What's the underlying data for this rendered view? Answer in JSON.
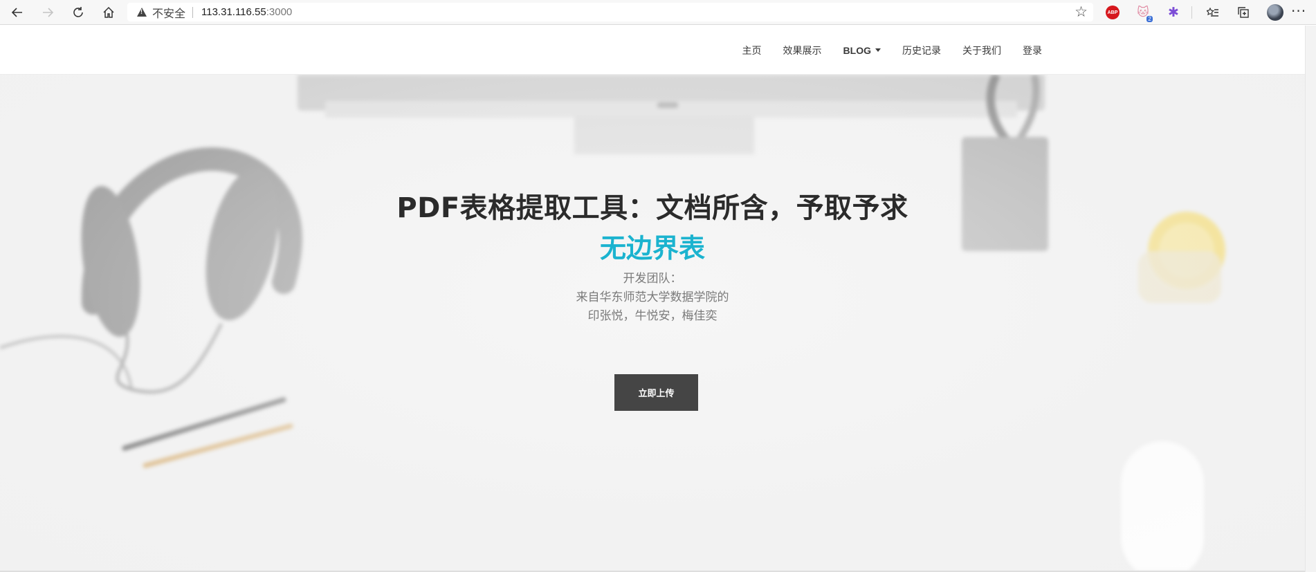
{
  "browser": {
    "security_label": "不安全",
    "url_host": "113.31.116.55",
    "url_port": ":3000",
    "extensions": [
      {
        "icon": "adblock-plus-icon",
        "label": "ABP"
      },
      {
        "icon": "cat-extension-icon",
        "badge": "2"
      },
      {
        "icon": "pinwheel-extension-icon"
      }
    ]
  },
  "nav": {
    "items": [
      {
        "label": "主页"
      },
      {
        "label": "效果展示"
      },
      {
        "label": "BLOG"
      },
      {
        "label": "历史记录"
      },
      {
        "label": "关于我们"
      },
      {
        "label": "登录"
      }
    ]
  },
  "hero": {
    "title": "PDF表格提取工具：文档所含，予取予求",
    "highlight": "无边界表",
    "description_lines": [
      "开发团队：",
      "来自华东师范大学数据学院的",
      "印张悦，牛悦安，梅佳奕"
    ],
    "cta_label": "立即上传"
  },
  "colors": {
    "accent": "#1bb3cf",
    "button_bg": "#454545",
    "title_text": "#2b2b2b"
  }
}
